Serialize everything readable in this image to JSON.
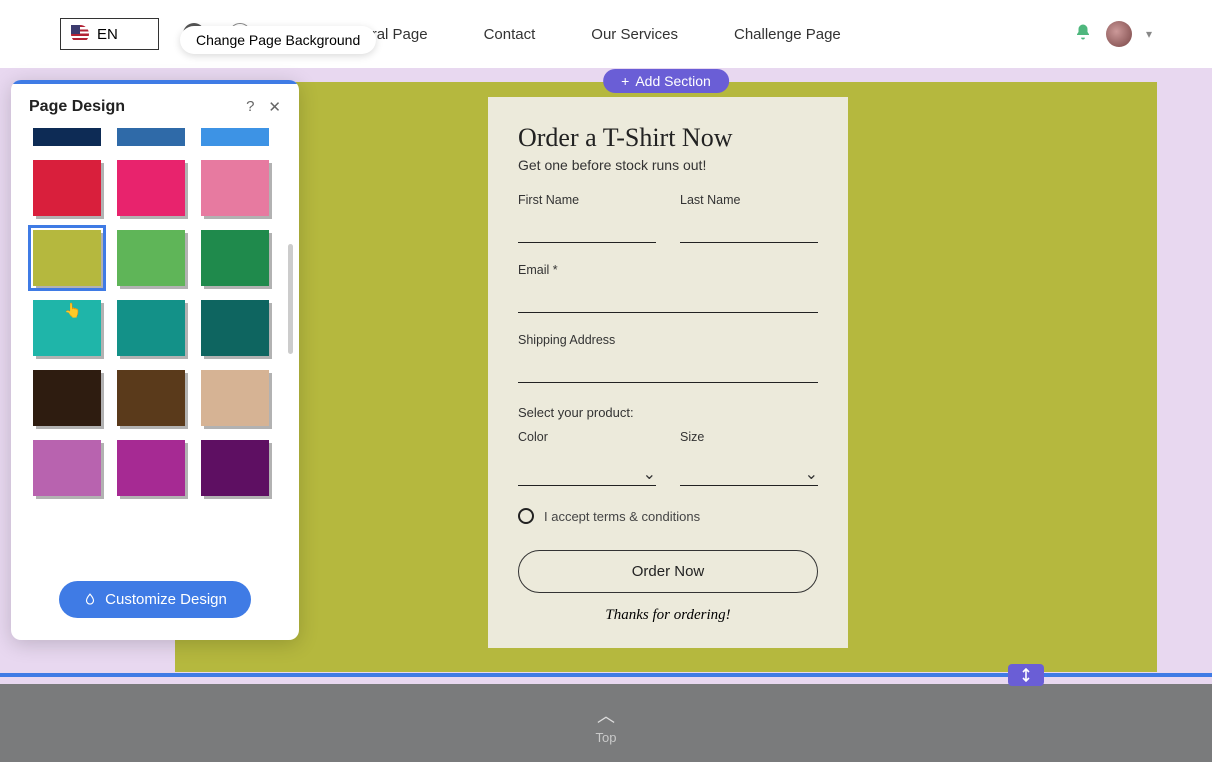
{
  "lang": {
    "code": "EN"
  },
  "tooltip": {
    "text": "Change Page Background"
  },
  "nav": {
    "items": [
      "New General Page",
      "Contact",
      "Our Services",
      "Challenge Page"
    ]
  },
  "add_section": "Add Section",
  "form": {
    "title": "Order a T-Shirt Now",
    "subtitle": "Get one before stock runs out!",
    "first_name": "First Name",
    "last_name": "Last Name",
    "email": "Email *",
    "shipping": "Shipping Address",
    "select_prod": "Select your product:",
    "color": "Color",
    "size": "Size",
    "terms": "I accept terms & conditions",
    "button": "Order Now",
    "thanks": "Thanks for ordering!"
  },
  "panel": {
    "title": "Page Design",
    "customize": "Customize Design",
    "colors": {
      "row_partial": [
        "#0d2b55",
        "#2f6aa8",
        "#3d93e5"
      ],
      "rows": [
        [
          "#d91f3c",
          "#e8236d",
          "#e77aa0"
        ],
        [
          "#b5b83e",
          "#5fb558",
          "#1f8a4c"
        ],
        [
          "#1fb5a9",
          "#139188",
          "#0e6560"
        ],
        [
          "#2e1c10",
          "#5a3a1b",
          "#d6b394"
        ],
        [
          "#b863af",
          "#a62a93",
          "#5e0f62"
        ]
      ],
      "selected_index": "1.0"
    }
  },
  "footer": {
    "top": "Top"
  }
}
